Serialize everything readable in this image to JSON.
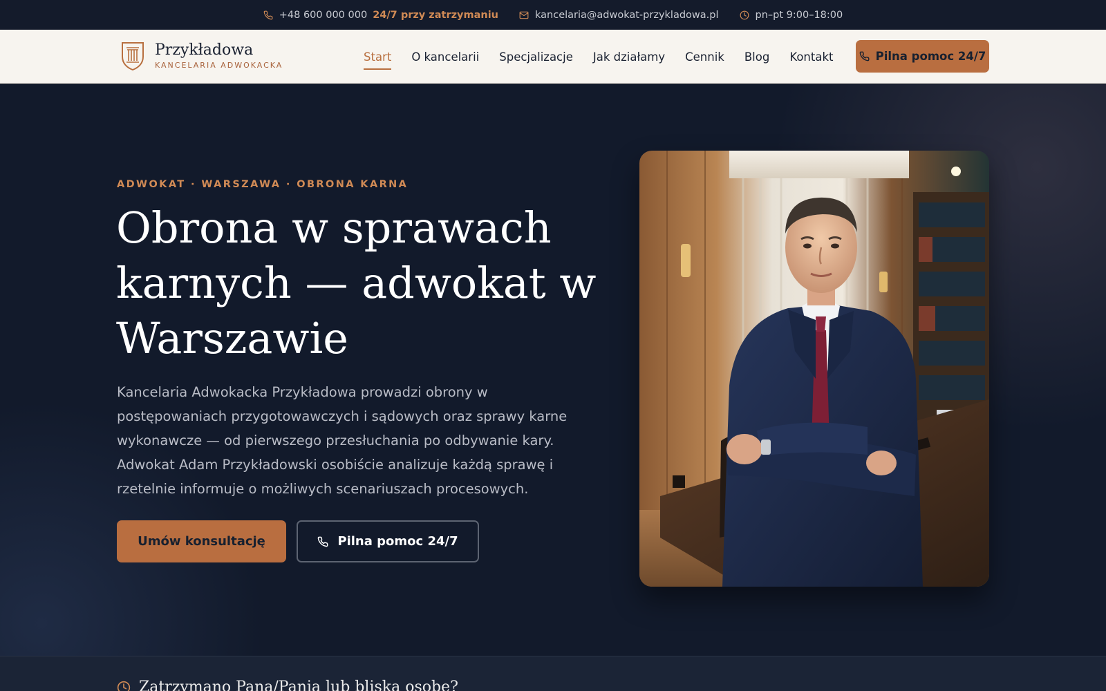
{
  "topbar": {
    "phone": "+48 600 000 000",
    "phone_note": "24/7 przy zatrzymaniu",
    "email": "kancelaria@adwokat-przykladowa.pl",
    "hours": "pn–pt 9:00–18:00",
    "icons": [
      "phone-icon",
      "mail-icon",
      "clock-icon"
    ]
  },
  "brand": {
    "name": "Przykładowa",
    "subtitle": "KANCELARIA ADWOKACKA",
    "logo_icon": "pillar-shield-icon"
  },
  "nav": {
    "items": [
      {
        "label": "Start",
        "active": true
      },
      {
        "label": "O kancelarii",
        "active": false
      },
      {
        "label": "Specjalizacje",
        "active": false
      },
      {
        "label": "Jak działamy",
        "active": false
      },
      {
        "label": "Cennik",
        "active": false
      },
      {
        "label": "Blog",
        "active": false
      },
      {
        "label": "Kontakt",
        "active": false
      }
    ],
    "cta": "Pilna pomoc 24/7"
  },
  "hero": {
    "eyebrow": "ADWOKAT · WARSZAWA · OBRONA KARNA",
    "title": "Obrona w sprawach karnych — adwokat w Warszawie",
    "lead": "Kancelaria Adwokacka Przykładowa prowadzi obrony w postępowaniach przygotowawczych i sądowych oraz sprawy karne wykonawcze — od pierwszego przesłuchania po odbywanie kary. Adwokat Adam Przykładowski osobiście analizuje każdą sprawę i rzetelnie informuje o możliwych scenariuszach procesowych.",
    "primary_button": "Umów konsultację",
    "secondary_button": "Pilna pomoc 24/7"
  },
  "alert_strip": {
    "text": "Zatrzymano Pana/Panią lub bliską osobę?"
  },
  "colors": {
    "accent": "#b96e40",
    "accent_text": "#d08a55",
    "dark_bg": "#121a2b",
    "header_bg": "#f7f4ef"
  }
}
